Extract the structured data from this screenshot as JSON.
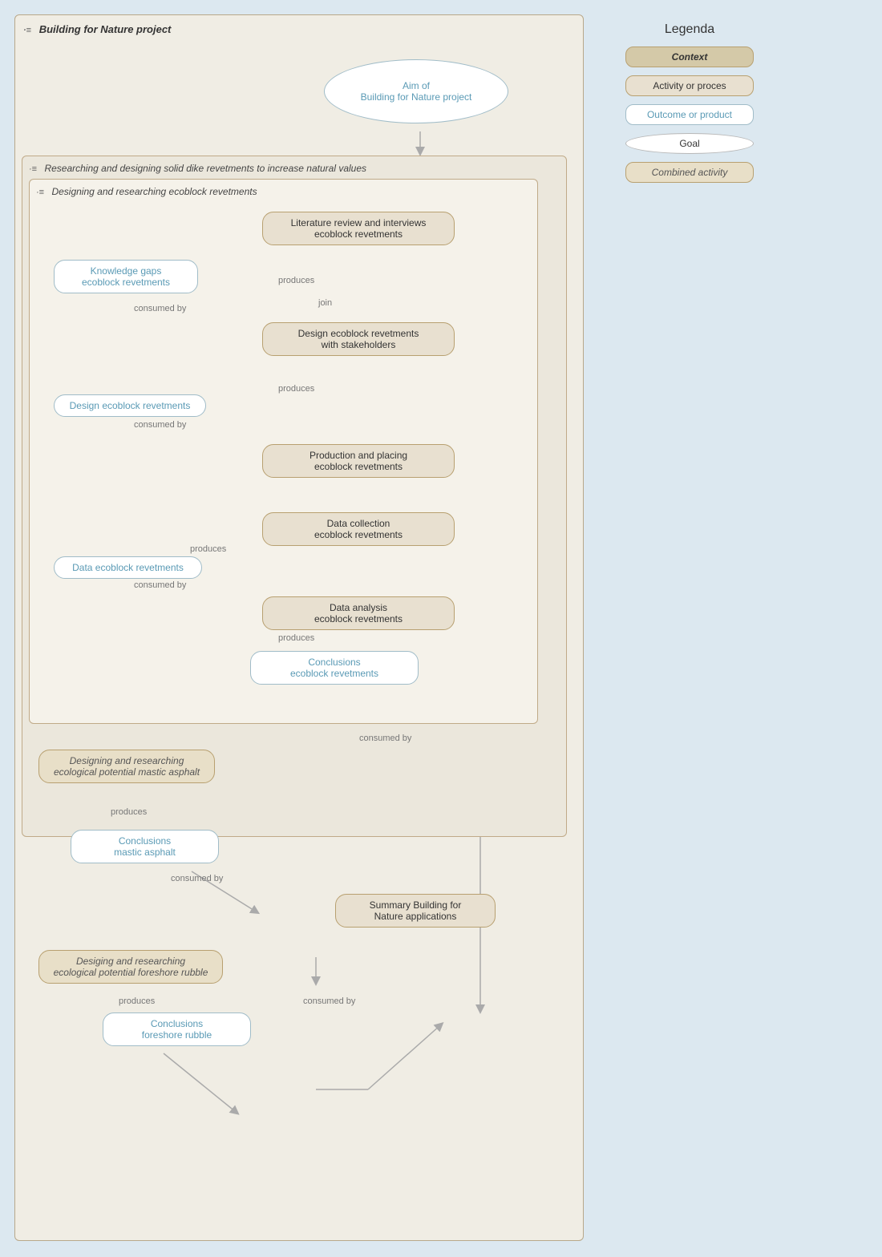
{
  "main": {
    "title": "Building for Nature project",
    "aim_label": "Aim of\nBuilding for Nature project",
    "outer_sub_title": "Researching and designing solid dike revetments to increase natural values",
    "inner_sub_title": "Designing and researching ecoblock revetments",
    "nodes": {
      "lit_review": "Literature review and interviews\necoblock revetments",
      "knowledge_gaps": "Knowledge gaps\necoblock revetments",
      "design_stakeholders": "Design ecoblock revetments\nwith stakeholders",
      "design_outcome": "Design ecoblock revetments",
      "production": "Production and placing\necoblock revetments",
      "data_collection": "Data collection\necoblock revetments",
      "data_outcome": "Data ecoblock revetments",
      "data_analysis": "Data analysis\necoblock revetments",
      "conclusions_eco": "Conclusions\necoblock revetments",
      "designing_mastic": "Designing and researching\necological potential mastic asphalt",
      "conclusions_mastic": "Conclusions\nmastic asphalt",
      "designing_foreshore": "Desiging and researching\necological potential foreshore rubble",
      "summary": "Summary Building for\nNature applications",
      "conclusions_foreshore": "Conclusions\nforeshore rubble"
    },
    "labels": {
      "produces": "produces",
      "consumed_by": "consumed by",
      "join": "join"
    }
  },
  "legenda": {
    "title": "Legenda",
    "items": [
      {
        "key": "context",
        "label": "Context",
        "style": "context"
      },
      {
        "key": "activity",
        "label": "Activity or proces",
        "style": "activity"
      },
      {
        "key": "outcome",
        "label": "Outcome or product",
        "style": "outcome"
      },
      {
        "key": "goal",
        "label": "Goal",
        "style": "goal"
      },
      {
        "key": "combined",
        "label": "Combined activity",
        "style": "combined"
      }
    ]
  }
}
